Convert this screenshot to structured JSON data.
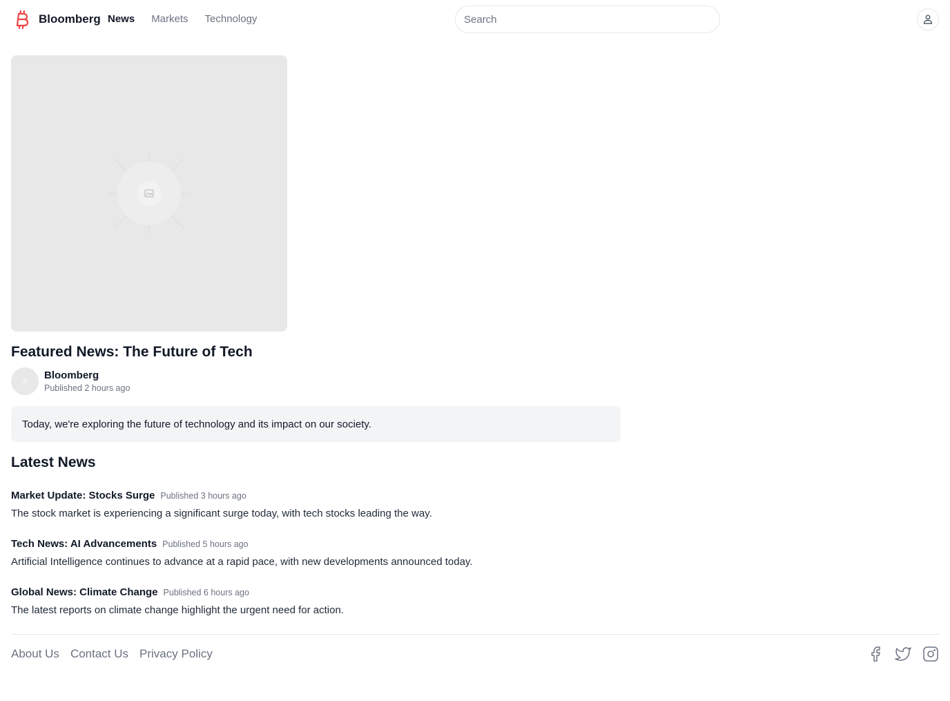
{
  "header": {
    "brand": "Bloomberg",
    "nav": [
      "News",
      "Markets",
      "Technology"
    ],
    "search_placeholder": "Search"
  },
  "featured": {
    "title": "Featured News: The Future of Tech",
    "author": "Bloomberg",
    "published": "Published 2 hours ago",
    "summary": "Today, we're exploring the future of technology and its impact on our society."
  },
  "latest": {
    "heading": "Latest News",
    "items": [
      {
        "title": "Market Update: Stocks Surge",
        "published": "Published 3 hours ago",
        "description": "The stock market is experiencing a significant surge today, with tech stocks leading the way."
      },
      {
        "title": "Tech News: AI Advancements",
        "published": "Published 5 hours ago",
        "description": "Artificial Intelligence continues to advance at a rapid pace, with new developments announced today."
      },
      {
        "title": "Global News: Climate Change",
        "published": "Published 6 hours ago",
        "description": "The latest reports on climate change highlight the urgent need for action."
      }
    ]
  },
  "footer": {
    "links": [
      "About Us",
      "Contact Us",
      "Privacy Policy"
    ],
    "socials": [
      "facebook-icon",
      "twitter-icon",
      "instagram-icon"
    ]
  },
  "colors": {
    "accent": "#ef4444",
    "text": "#111827",
    "muted": "#6b7280",
    "panel": "#f3f4f6",
    "placeholder": "#e8e8e8"
  }
}
